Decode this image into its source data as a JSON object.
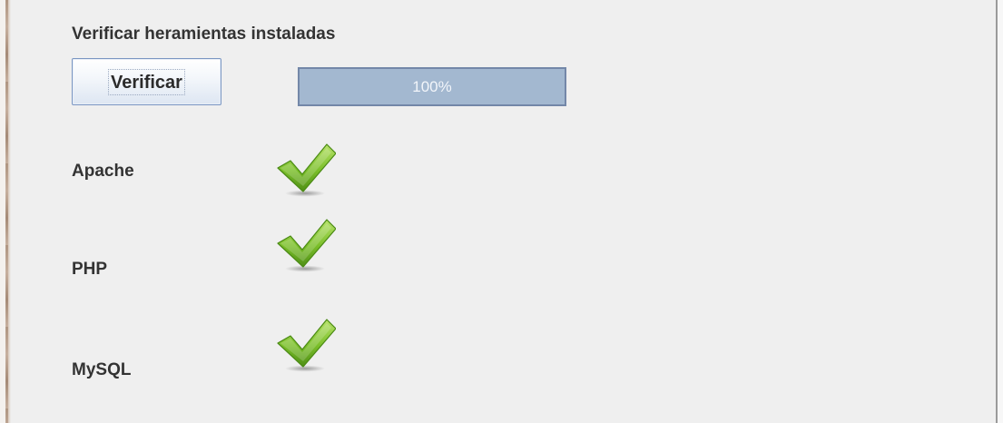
{
  "section": {
    "title": "Verificar heramientas instaladas"
  },
  "verify_button": {
    "label": "Verificar"
  },
  "progress": {
    "value_percent": 100,
    "text": "100%"
  },
  "tools": [
    {
      "label": "Apache",
      "status_icon": "check-icon",
      "status_color": "#7bbf2a"
    },
    {
      "label": "PHP",
      "status_icon": "check-icon",
      "status_color": "#7bbf2a"
    },
    {
      "label": "MySQL",
      "status_icon": "check-icon",
      "status_color": "#7bbf2a"
    }
  ],
  "colors": {
    "background": "#efefef",
    "progress_fill": "#a3b8d0",
    "progress_border": "#7387a8",
    "check_green": "#7bbf2a"
  }
}
